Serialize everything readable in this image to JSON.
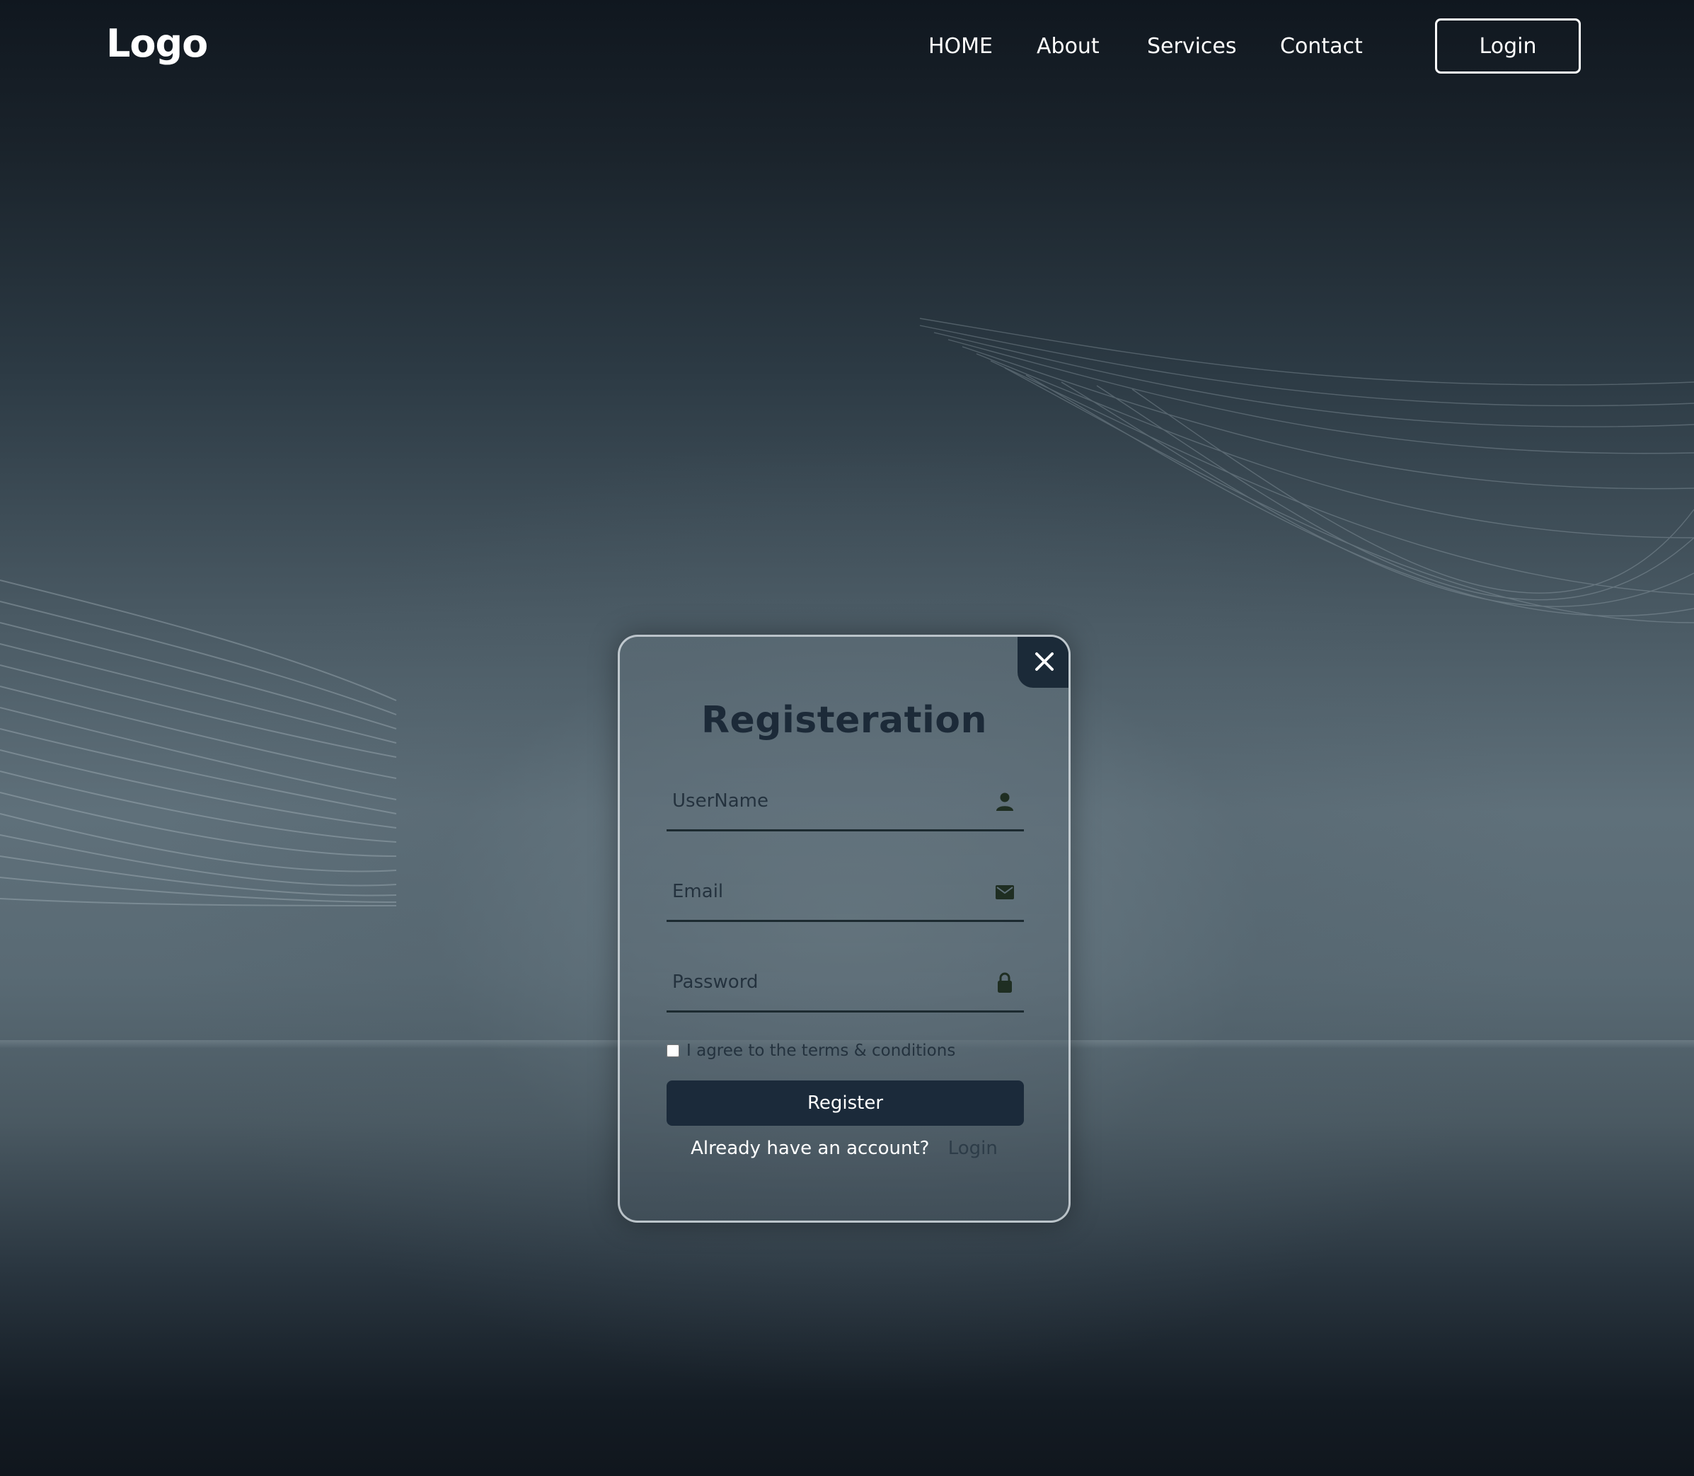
{
  "header": {
    "logo": "Logo",
    "nav": [
      {
        "label": "HOME"
      },
      {
        "label": "About"
      },
      {
        "label": "Services"
      },
      {
        "label": "Contact"
      }
    ],
    "login_label": "Login"
  },
  "modal": {
    "title": "Registeration",
    "close_icon": "close-icon",
    "fields": {
      "username": {
        "placeholder": "UserName",
        "value": "",
        "icon": "user-icon"
      },
      "email": {
        "placeholder": "Email",
        "value": "",
        "icon": "mail-icon"
      },
      "password": {
        "placeholder": "Password",
        "value": "",
        "icon": "lock-icon"
      }
    },
    "agree_label": "I agree to the terms & conditions",
    "agree_checked": false,
    "register_label": "Register",
    "account_question": "Already have an account?",
    "account_login_label": "Login"
  },
  "colors": {
    "accent": "#1b2a3a",
    "title": "#1c2a38",
    "field_line": "#1c2a30",
    "icon": "#1f2e22"
  }
}
